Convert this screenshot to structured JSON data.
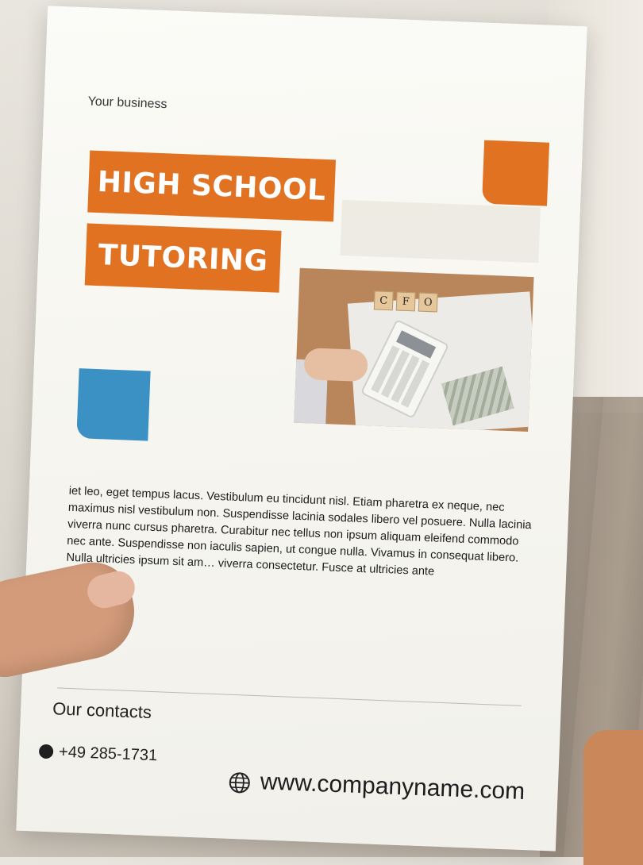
{
  "flyer": {
    "business": "Your business",
    "title_line1": "HIGH SCHOOL",
    "title_line2": "TUTORING",
    "photo_cubes": [
      "C",
      "F",
      "O"
    ],
    "body_text": "iet leo, eget tempus lacus. Vestibulum eu tincidunt nisl. Etiam pharetra ex neque, nec maximus nisl vestibulum non. Suspendisse lacinia sodales libero vel posuere. Nulla lacinia viverra nunc cursus pharetra. Curabitur nec tellus non ipsum aliquam eleifend commodo nec ante. Suspendisse non iaculis sapien, ut congue nulla. Vivamus in consequat libero. Nulla ultricies ipsum sit am… viverra consectetur. Fusce at ultricies ante",
    "contacts_title": "Our contacts",
    "phone": "+49 285-1731",
    "website": "www.companyname.com"
  },
  "colors": {
    "accent_orange": "#e07222",
    "accent_blue": "#3b90c4"
  },
  "icons": [
    "phone-icon",
    "globe-icon"
  ]
}
